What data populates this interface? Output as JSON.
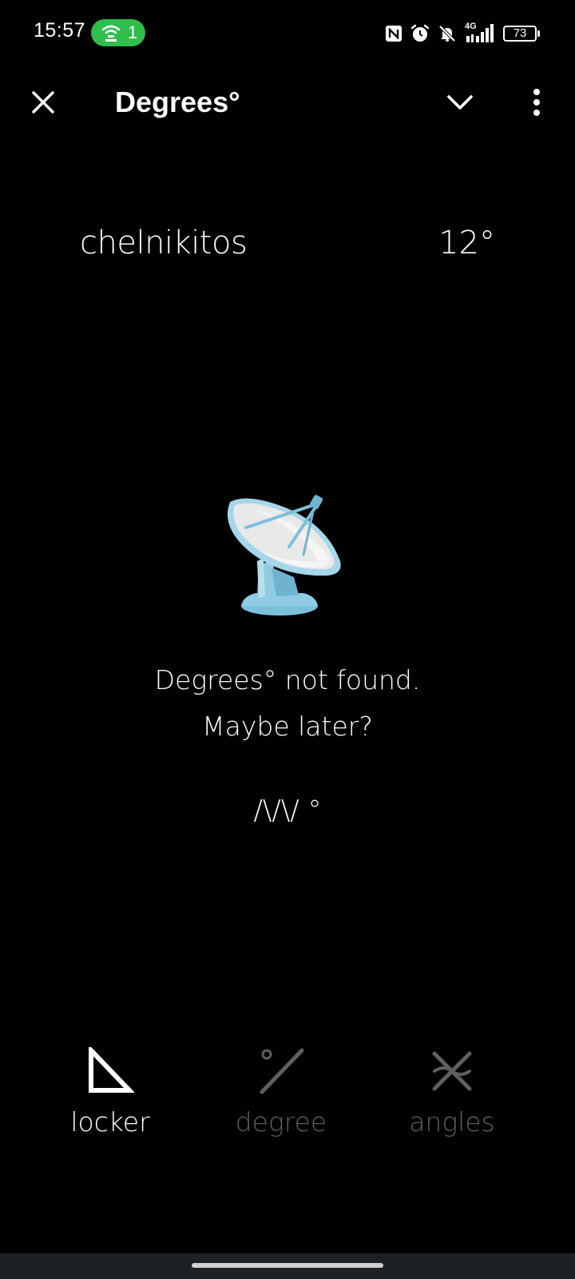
{
  "status_bar": {
    "time": "15:57",
    "hotspot_count": "1",
    "network": "4G",
    "battery": "73",
    "colors": {
      "hotspot_pill": "#2fbd4b"
    }
  },
  "app_bar": {
    "title": "Degrees°",
    "icons": [
      "close-icon",
      "chevron-down-icon",
      "more-vert-icon"
    ]
  },
  "user": {
    "name": "chelnikitos",
    "degree": "12°"
  },
  "empty_state": {
    "icon": "satellite-dish-icon",
    "line1": "Degrees° not found.",
    "line2": "Maybe later?",
    "kaomoji": "/\\/\\/ °"
  },
  "bottom_nav": {
    "items": [
      {
        "label": "locker",
        "icon": "triangle-icon",
        "active": true
      },
      {
        "label": "degree",
        "icon": "degree-slash-icon",
        "active": false
      },
      {
        "label": "angles",
        "icon": "crossed-angles-icon",
        "active": false
      }
    ],
    "colors": {
      "active": "#ffffff",
      "inactive": "#5f5f5f"
    }
  }
}
